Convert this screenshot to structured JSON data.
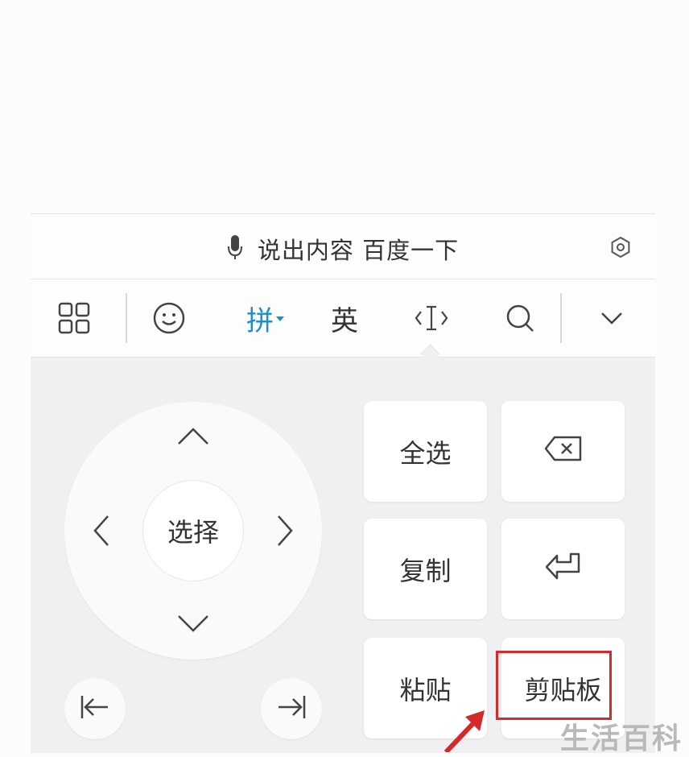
{
  "voice_bar": {
    "text": "说出内容 百度一下",
    "mic_icon": "microphone-icon",
    "settings_icon": "hexagon-settings-icon"
  },
  "toolbar": {
    "items": [
      {
        "name": "grid-menu",
        "icon": "grid-icon"
      },
      {
        "name": "emoji",
        "icon": "smiley-icon"
      },
      {
        "name": "pinyin",
        "label": "拼",
        "active": true
      },
      {
        "name": "english",
        "label": "英"
      },
      {
        "name": "cursor-edit",
        "icon": "cursor-edit-icon",
        "active": true
      },
      {
        "name": "search",
        "icon": "search-icon"
      },
      {
        "name": "collapse",
        "icon": "chevron-down-icon"
      }
    ],
    "active_color": "#1a8fd0"
  },
  "dpad": {
    "center_label": "选择",
    "arrows": [
      "up",
      "left",
      "right",
      "down"
    ]
  },
  "keys": {
    "select_all": "全选",
    "copy": "复制",
    "paste": "粘贴",
    "clipboard": "剪贴板",
    "backspace_icon": "backspace-icon",
    "enter_icon": "enter-icon"
  },
  "bottom_buttons": {
    "home_icon": "jump-to-start-icon",
    "end_icon": "jump-to-end-icon"
  },
  "annotation": {
    "highlight_color": "#d62a2a"
  },
  "watermark": "生活百科"
}
